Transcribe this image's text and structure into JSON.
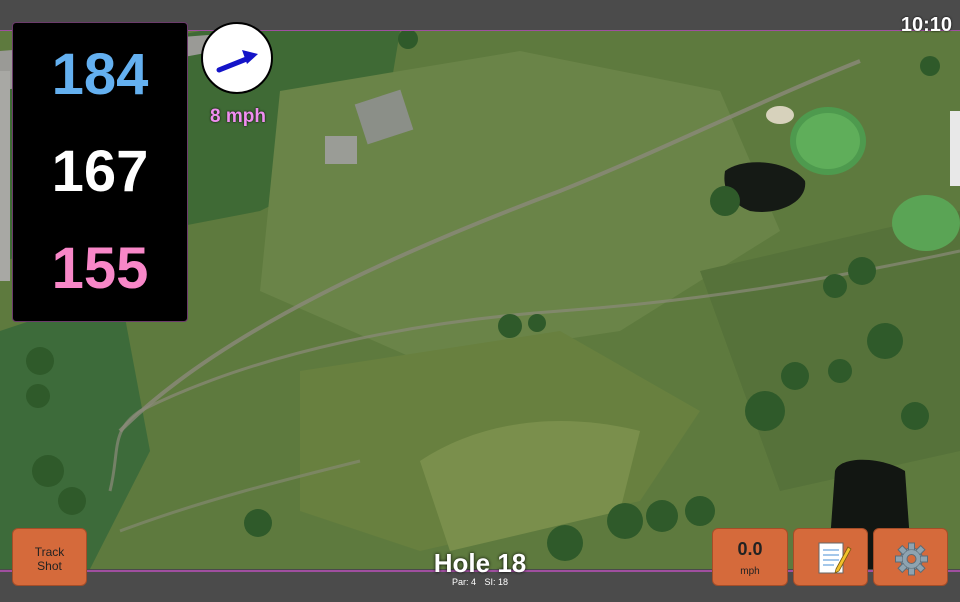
{
  "status": {
    "time": "10:10"
  },
  "distances": {
    "back": "184",
    "middle": "167",
    "front": "155"
  },
  "wind": {
    "speed": "8 mph",
    "icon": "wind-direction-arrow-icon"
  },
  "hole": {
    "title": "Hole 18",
    "par": "Par: 4",
    "stroke_index": "SI: 18"
  },
  "buttons": {
    "track_line1": "Track",
    "track_line2": "Shot",
    "speed_value": "0.0",
    "speed_unit": "mph",
    "notes_icon": "notepad-icon",
    "settings_icon": "gear-icon"
  },
  "colors": {
    "back_distance": "#64b0f0",
    "middle_distance": "#ffffff",
    "front_distance": "#f887c8",
    "button": "#d56a3b",
    "accent_border": "#a04fa0"
  }
}
